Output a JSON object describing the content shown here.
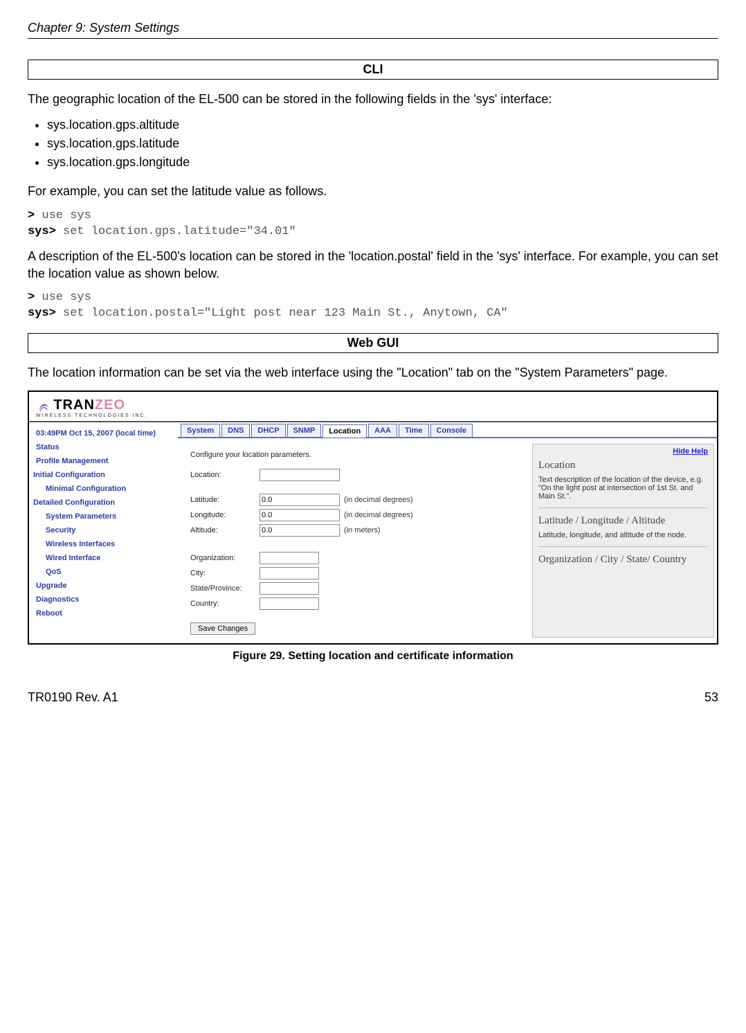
{
  "header": {
    "chapter": "Chapter 9: System Settings"
  },
  "cli": {
    "heading": "CLI",
    "intro": "The geographic location of the EL-500 can be stored in the following fields in the 'sys' interface:",
    "bullets": [
      "sys.location.gps.altitude",
      "sys.location.gps.latitude",
      "sys.location.gps.longitude"
    ],
    "example1_lead": "For example, you can set the latitude value as follows.",
    "code1_l1a": ">",
    "code1_l1b": " use sys",
    "code1_l2a": "sys>",
    "code1_l2b": " set location.gps.latitude=\"34.01\"",
    "mid": "A description of the EL-500's location can be stored in the 'location.postal' field in the 'sys' interface. For example, you can set the location value as shown below.",
    "code2_l1a": ">",
    "code2_l1b": " use sys",
    "code2_l2a": "sys>",
    "code2_l2b": " set location.postal=\"Light post near 123 Main St., Anytown, CA\""
  },
  "webgui": {
    "heading": "Web GUI",
    "intro": "The location information can be set via the web interface using the \"Location\" tab on the \"System Parameters\" page."
  },
  "screenshot": {
    "logo": {
      "tran": "TRAN",
      "zeo": "ZEO",
      "sub": "WIRELESS  TECHNOLOGIES INC."
    },
    "timestamp": "03:49PM Oct 15, 2007 (local time)",
    "sidebar": {
      "status": "Status",
      "profile": "Profile Management",
      "initial_head": "Initial Configuration",
      "minimal": "Minimal Configuration",
      "detailed_head": "Detailed Configuration",
      "sysparams": "System Parameters",
      "security": "Security",
      "wireless": "Wireless Interfaces",
      "wired": "Wired Interface",
      "qos": "QoS",
      "upgrade": "Upgrade",
      "diagnostics": "Diagnostics",
      "reboot": "Reboot"
    },
    "tabs": {
      "system": "System",
      "dns": "DNS",
      "dhcp": "DHCP",
      "snmp": "SNMP",
      "location": "Location",
      "aaa": "AAA",
      "time": "Time",
      "console": "Console"
    },
    "form": {
      "intro": "Configure your location parameters.",
      "location_label": "Location:",
      "lat_label": "Latitude:",
      "lat_value": "0.0",
      "lat_hint": "(in decimal degrees)",
      "lon_label": "Longitude:",
      "lon_value": "0.0",
      "lon_hint": "(in decimal degrees)",
      "alt_label": "Altitude:",
      "alt_value": "0.0",
      "alt_hint": "(in meters)",
      "org_label": "Organization:",
      "city_label": "City:",
      "state_label": "State/Province:",
      "country_label": "Country:",
      "save": "Save Changes"
    },
    "help": {
      "hide": "Hide Help",
      "h1": "Location",
      "p1": "Text description of the location of the device, e.g. \"On the light post at intersection of 1st St. and Main St.\".",
      "h2": "Latitude / Longitude / Altitude",
      "p2": "Latitude, longitude, and altitude of the node.",
      "h3": "Organization / City / State/ Country"
    }
  },
  "figure": {
    "caption": "Figure 29. Setting location and certificate information"
  },
  "footer": {
    "left": "TR0190 Rev. A1",
    "right": "53"
  }
}
